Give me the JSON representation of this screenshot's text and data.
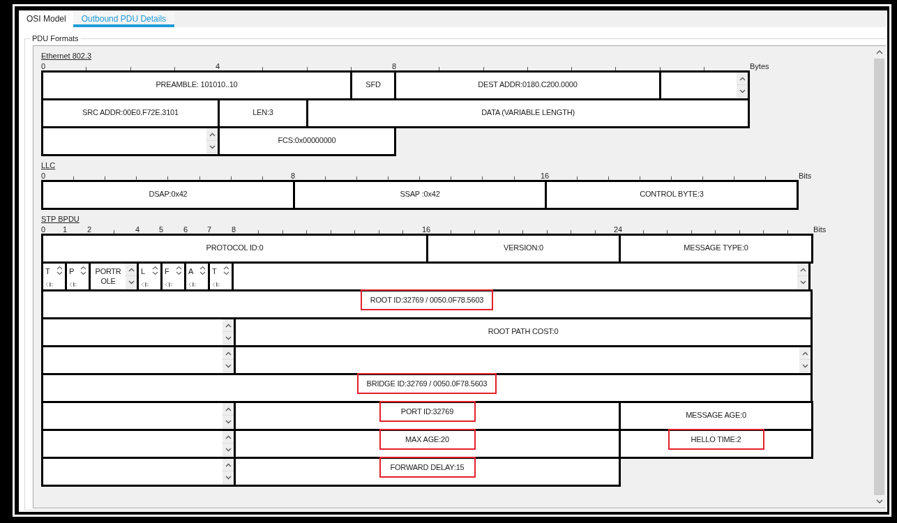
{
  "tabs": [
    {
      "label": "OSI Model",
      "selected": false
    },
    {
      "label": "Outbound PDU Details",
      "selected": true
    }
  ],
  "group_title": "PDU Formats",
  "sections": [
    {
      "title": "Ethernet 802.3",
      "ruler": {
        "labels": [
          "0",
          "4",
          "8"
        ],
        "unit": "Bytes"
      },
      "lines": [
        {
          "fields": [
            {
              "kind": "text",
              "label": "PREAMBLE: 101010..10",
              "highlighted": false
            },
            {
              "kind": "text",
              "label": "SFD",
              "highlighted": false
            },
            {
              "kind": "text",
              "label": "DEST ADDR:0180.C200.0000",
              "highlighted": false
            },
            {
              "kind": "scroll"
            }
          ]
        },
        {
          "fields": [
            {
              "kind": "text",
              "label": "SRC ADDR:00E0.F72E.3101",
              "highlighted": false
            },
            {
              "kind": "text",
              "label": "LEN:3",
              "highlighted": false
            },
            {
              "kind": "text",
              "label": "DATA (VARIABLE LENGTH)",
              "highlighted": false
            }
          ]
        },
        {
          "fields": [
            {
              "kind": "scroll"
            },
            {
              "kind": "text",
              "label": "FCS:0x00000000",
              "highlighted": false
            }
          ]
        }
      ]
    },
    {
      "title": "LLC",
      "ruler": {
        "labels": [
          "0",
          "8",
          "16"
        ],
        "unit": "Bits"
      },
      "lines": [
        {
          "fields": [
            {
              "kind": "text",
              "label": "DSAP:0x42",
              "highlighted": false
            },
            {
              "kind": "text",
              "label": "SSAP :0x42",
              "highlighted": false
            },
            {
              "kind": "text",
              "label": "CONTROL BYTE:3",
              "highlighted": false
            }
          ]
        }
      ]
    },
    {
      "title": "STP BPDU",
      "ruler": {
        "labels": [
          "0",
          "1",
          "2",
          "4",
          "5",
          "6",
          "7",
          "8",
          "16",
          "24"
        ],
        "unit": "Bits"
      },
      "lines": [
        {
          "fields": [
            {
              "kind": "text",
              "label": "PROTOCOL ID:0",
              "highlighted": false
            },
            {
              "kind": "text",
              "label": "VERSION:0",
              "highlighted": false
            },
            {
              "kind": "text",
              "label": "MESSAGE TYPE:0",
              "highlighted": false
            }
          ]
        },
        {
          "fields": [
            {
              "kind": "flag",
              "label": "T"
            },
            {
              "kind": "flag",
              "label": "P"
            },
            {
              "kind": "flag_wide",
              "label": "PORTROLE"
            },
            {
              "kind": "flag",
              "label": "L"
            },
            {
              "kind": "flag",
              "label": "F"
            },
            {
              "kind": "flag",
              "label": "A"
            },
            {
              "kind": "flag",
              "label": "T"
            },
            {
              "kind": "scroll"
            }
          ]
        },
        {
          "fields": [
            {
              "kind": "text",
              "label": "ROOT ID:32769 / 0050.0F78.5603",
              "highlighted": true
            }
          ]
        },
        {
          "fields": [
            {
              "kind": "scroll"
            },
            {
              "kind": "text",
              "label": "ROOT PATH COST:0",
              "highlighted": false
            }
          ]
        },
        {
          "fields": [
            {
              "kind": "scroll"
            },
            {
              "kind": "scroll"
            }
          ]
        },
        {
          "fields": [
            {
              "kind": "text",
              "label": "BRIDGE ID:32769 / 0050.0F78.5603",
              "highlighted": true
            }
          ]
        },
        {
          "fields": [
            {
              "kind": "scroll"
            },
            {
              "kind": "text",
              "label": "PORT ID:32769",
              "highlighted": true
            },
            {
              "kind": "text",
              "label": "MESSAGE AGE:0",
              "highlighted": false
            }
          ]
        },
        {
          "fields": [
            {
              "kind": "scroll"
            },
            {
              "kind": "text",
              "label": "MAX AGE:20",
              "highlighted": true
            },
            {
              "kind": "text",
              "label": "HELLO TIME:2",
              "highlighted": true
            }
          ]
        },
        {
          "fields": [
            {
              "kind": "scroll"
            },
            {
              "kind": "text",
              "label": "FORWARD DELAY:15",
              "highlighted": true
            }
          ]
        }
      ]
    }
  ]
}
